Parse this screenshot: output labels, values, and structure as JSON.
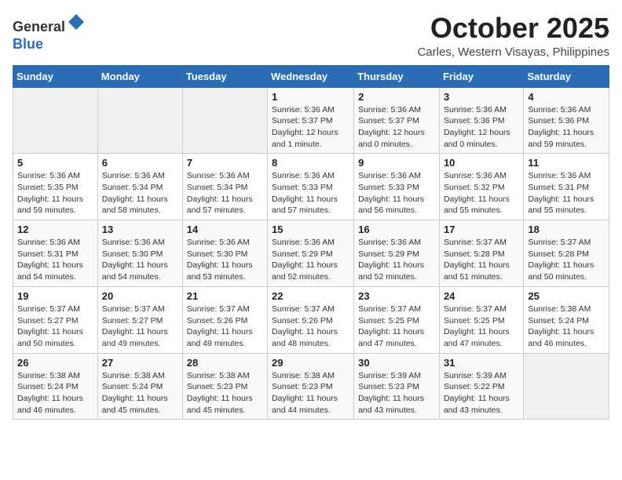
{
  "header": {
    "logo_line1": "General",
    "logo_line2": "Blue",
    "month": "October 2025",
    "location": "Carles, Western Visayas, Philippines"
  },
  "weekdays": [
    "Sunday",
    "Monday",
    "Tuesday",
    "Wednesday",
    "Thursday",
    "Friday",
    "Saturday"
  ],
  "weeks": [
    [
      {
        "day": "",
        "info": ""
      },
      {
        "day": "",
        "info": ""
      },
      {
        "day": "",
        "info": ""
      },
      {
        "day": "1",
        "info": "Sunrise: 5:36 AM\nSunset: 5:37 PM\nDaylight: 12 hours\nand 1 minute."
      },
      {
        "day": "2",
        "info": "Sunrise: 5:36 AM\nSunset: 5:37 PM\nDaylight: 12 hours\nand 0 minutes."
      },
      {
        "day": "3",
        "info": "Sunrise: 5:36 AM\nSunset: 5:36 PM\nDaylight: 12 hours\nand 0 minutes."
      },
      {
        "day": "4",
        "info": "Sunrise: 5:36 AM\nSunset: 5:36 PM\nDaylight: 11 hours\nand 59 minutes."
      }
    ],
    [
      {
        "day": "5",
        "info": "Sunrise: 5:36 AM\nSunset: 5:35 PM\nDaylight: 11 hours\nand 59 minutes."
      },
      {
        "day": "6",
        "info": "Sunrise: 5:36 AM\nSunset: 5:34 PM\nDaylight: 11 hours\nand 58 minutes."
      },
      {
        "day": "7",
        "info": "Sunrise: 5:36 AM\nSunset: 5:34 PM\nDaylight: 11 hours\nand 57 minutes."
      },
      {
        "day": "8",
        "info": "Sunrise: 5:36 AM\nSunset: 5:33 PM\nDaylight: 11 hours\nand 57 minutes."
      },
      {
        "day": "9",
        "info": "Sunrise: 5:36 AM\nSunset: 5:33 PM\nDaylight: 11 hours\nand 56 minutes."
      },
      {
        "day": "10",
        "info": "Sunrise: 5:36 AM\nSunset: 5:32 PM\nDaylight: 11 hours\nand 55 minutes."
      },
      {
        "day": "11",
        "info": "Sunrise: 5:36 AM\nSunset: 5:31 PM\nDaylight: 11 hours\nand 55 minutes."
      }
    ],
    [
      {
        "day": "12",
        "info": "Sunrise: 5:36 AM\nSunset: 5:31 PM\nDaylight: 11 hours\nand 54 minutes."
      },
      {
        "day": "13",
        "info": "Sunrise: 5:36 AM\nSunset: 5:30 PM\nDaylight: 11 hours\nand 54 minutes."
      },
      {
        "day": "14",
        "info": "Sunrise: 5:36 AM\nSunset: 5:30 PM\nDaylight: 11 hours\nand 53 minutes."
      },
      {
        "day": "15",
        "info": "Sunrise: 5:36 AM\nSunset: 5:29 PM\nDaylight: 11 hours\nand 52 minutes."
      },
      {
        "day": "16",
        "info": "Sunrise: 5:36 AM\nSunset: 5:29 PM\nDaylight: 11 hours\nand 52 minutes."
      },
      {
        "day": "17",
        "info": "Sunrise: 5:37 AM\nSunset: 5:28 PM\nDaylight: 11 hours\nand 51 minutes."
      },
      {
        "day": "18",
        "info": "Sunrise: 5:37 AM\nSunset: 5:28 PM\nDaylight: 11 hours\nand 50 minutes."
      }
    ],
    [
      {
        "day": "19",
        "info": "Sunrise: 5:37 AM\nSunset: 5:27 PM\nDaylight: 11 hours\nand 50 minutes."
      },
      {
        "day": "20",
        "info": "Sunrise: 5:37 AM\nSunset: 5:27 PM\nDaylight: 11 hours\nand 49 minutes."
      },
      {
        "day": "21",
        "info": "Sunrise: 5:37 AM\nSunset: 5:26 PM\nDaylight: 11 hours\nand 49 minutes."
      },
      {
        "day": "22",
        "info": "Sunrise: 5:37 AM\nSunset: 5:26 PM\nDaylight: 11 hours\nand 48 minutes."
      },
      {
        "day": "23",
        "info": "Sunrise: 5:37 AM\nSunset: 5:25 PM\nDaylight: 11 hours\nand 47 minutes."
      },
      {
        "day": "24",
        "info": "Sunrise: 5:37 AM\nSunset: 5:25 PM\nDaylight: 11 hours\nand 47 minutes."
      },
      {
        "day": "25",
        "info": "Sunrise: 5:38 AM\nSunset: 5:24 PM\nDaylight: 11 hours\nand 46 minutes."
      }
    ],
    [
      {
        "day": "26",
        "info": "Sunrise: 5:38 AM\nSunset: 5:24 PM\nDaylight: 11 hours\nand 46 minutes."
      },
      {
        "day": "27",
        "info": "Sunrise: 5:38 AM\nSunset: 5:24 PM\nDaylight: 11 hours\nand 45 minutes."
      },
      {
        "day": "28",
        "info": "Sunrise: 5:38 AM\nSunset: 5:23 PM\nDaylight: 11 hours\nand 45 minutes."
      },
      {
        "day": "29",
        "info": "Sunrise: 5:38 AM\nSunset: 5:23 PM\nDaylight: 11 hours\nand 44 minutes."
      },
      {
        "day": "30",
        "info": "Sunrise: 5:39 AM\nSunset: 5:23 PM\nDaylight: 11 hours\nand 43 minutes."
      },
      {
        "day": "31",
        "info": "Sunrise: 5:39 AM\nSunset: 5:22 PM\nDaylight: 11 hours\nand 43 minutes."
      },
      {
        "day": "",
        "info": ""
      }
    ]
  ]
}
